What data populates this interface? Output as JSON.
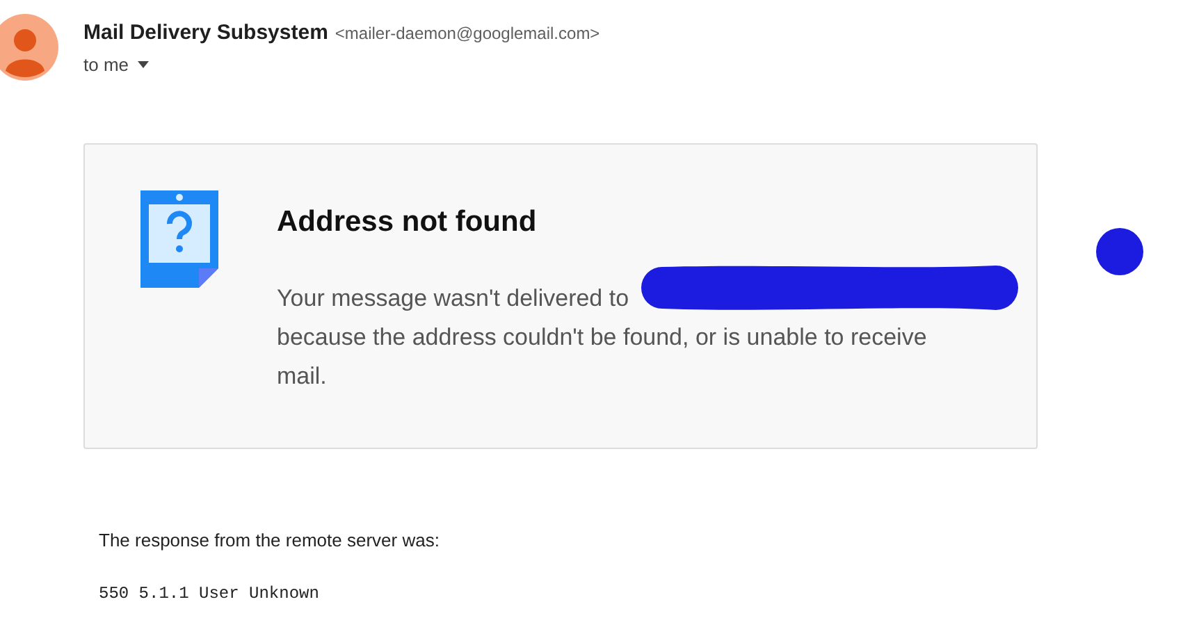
{
  "sender": {
    "name": "Mail Delivery Subsystem",
    "address": "<mailer-daemon@googlemail.com>",
    "recipient": "to me"
  },
  "notice": {
    "title": "Address not found",
    "message_start": "Your message wasn't delivered to",
    "message_rest": "because the address couldn't be found, or is unable to receive mail."
  },
  "response": {
    "intro": "The response from the remote server was:",
    "code": "550 5.1.1 User Unknown"
  }
}
